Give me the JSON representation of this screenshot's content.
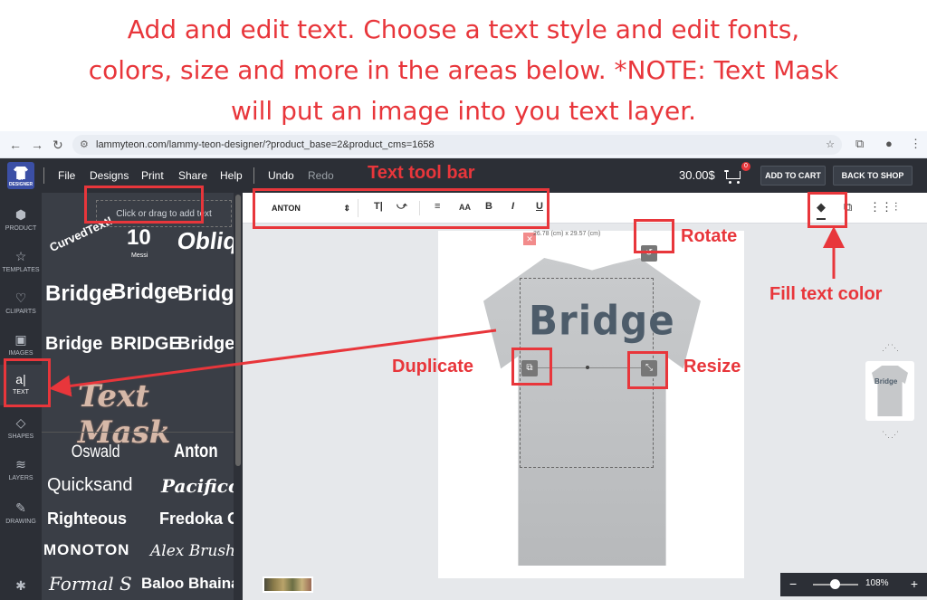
{
  "instructions": {
    "line1": "Add and edit text. Choose a text style and edit fonts,",
    "line2": "colors, size and more in the areas below. *NOTE: Text Mask",
    "line3": "will put an image into you text layer."
  },
  "browser": {
    "url": "lammyteon.com/lammy-teon-designer/?product_base=2&product_cms=1658"
  },
  "header": {
    "logo_text": "LT DESIGNER",
    "menu": [
      "File",
      "Designs",
      "Print",
      "Share",
      "Help"
    ],
    "undo": "Undo",
    "redo": "Redo",
    "price": "30.00$",
    "cart_count": "0",
    "add_to_cart": "ADD TO CART",
    "back_to_shop": "BACK TO SHOP"
  },
  "rail": [
    {
      "label": "PRODUCT",
      "icon": "box-icon"
    },
    {
      "label": "TEMPLATES",
      "icon": "star-icon"
    },
    {
      "label": "CLIPARTS",
      "icon": "heart-icon"
    },
    {
      "label": "IMAGES",
      "icon": "image-icon"
    },
    {
      "label": "TEXT",
      "icon": "text-icon"
    },
    {
      "label": "SHAPES",
      "icon": "diamond-icon"
    },
    {
      "label": "LAYERS",
      "icon": "layers-icon"
    },
    {
      "label": "DRAWING",
      "icon": "pencil-icon"
    }
  ],
  "panel": {
    "add_text": "Click or drag to add text",
    "styles": {
      "curved": "CurvedText!",
      "number": "10",
      "number_sub": "Messi",
      "oblique": "Obliqu",
      "bridge": "Bridge",
      "bridge_caps": "BRIDGE",
      "text_mask": "Text Mask"
    },
    "fonts": [
      "Oswald",
      "Anton",
      "Quicksand",
      "Pacifico",
      "Righteous",
      "Fredoka One",
      "MONOTON",
      "Alex Brush",
      "Formal S",
      "Baloo Bhaina"
    ]
  },
  "toolbar": {
    "font": "ANTON",
    "bold": "B",
    "italic": "I",
    "underline": "U",
    "font_size": "AA"
  },
  "canvas": {
    "text": "Bridge",
    "dimensions": "26.78 (cm) x 29.57 (cm)",
    "preview_text": "Bridge",
    "zoom": "108%"
  },
  "annotations": {
    "text_tool_bar": "Text tool bar",
    "rotate": "Rotate",
    "fill_text_color": "Fill text color",
    "duplicate": "Duplicate",
    "resize": "Resize"
  },
  "colors": {
    "accent_red": "#e8363b",
    "app_dark": "#2c2f36",
    "text_color": "#4d5c6a"
  }
}
